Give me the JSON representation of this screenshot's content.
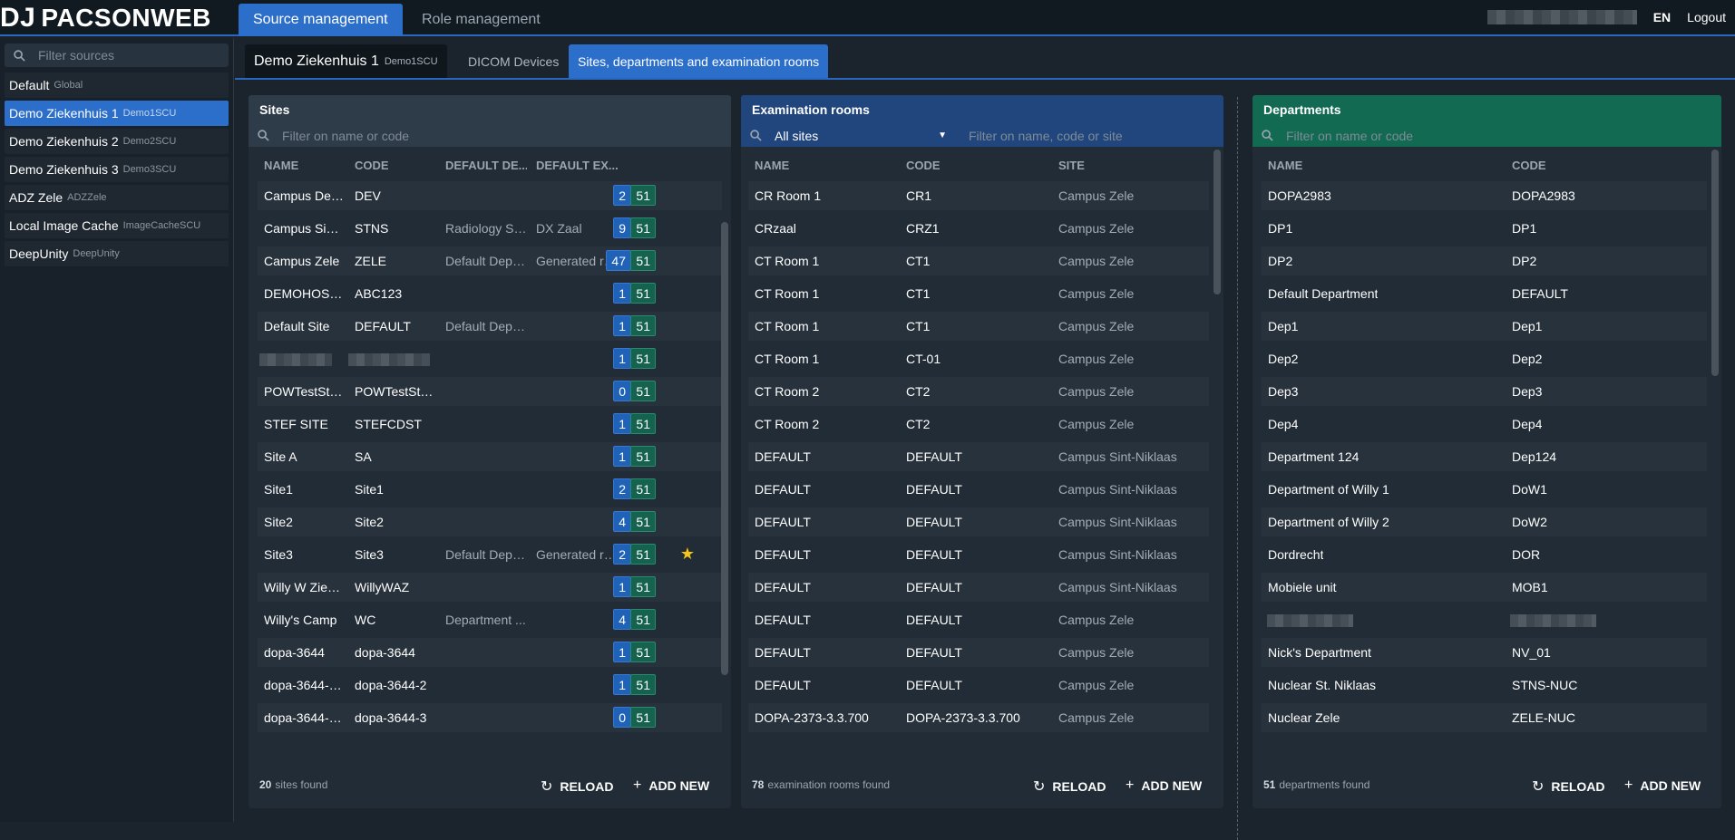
{
  "app": {
    "logo_mark": "DJ",
    "logo_text": "PACSONWEB"
  },
  "top_tabs": [
    "Source management",
    "Role management"
  ],
  "top_right": {
    "language": "EN",
    "logout": "Logout"
  },
  "sidebar": {
    "filter_placeholder": "Filter sources",
    "items": [
      {
        "name": "Default",
        "code": "Global"
      },
      {
        "name": "Demo Ziekenhuis 1",
        "code": "Demo1SCU"
      },
      {
        "name": "Demo Ziekenhuis 2",
        "code": "Demo2SCU"
      },
      {
        "name": "Demo Ziekenhuis 3",
        "code": "Demo3SCU"
      },
      {
        "name": "ADZ Zele",
        "code": "ADZZele"
      },
      {
        "name": "Local Image Cache",
        "code": "ImageCacheSCU"
      },
      {
        "name": "DeepUnity",
        "code": "DeepUnity"
      }
    ]
  },
  "subtabs": {
    "source_name": "Demo Ziekenhuis 1",
    "source_code": "Demo1SCU",
    "dicom": "DICOM Devices",
    "sites": "Sites, departments and examination rooms"
  },
  "sites": {
    "title": "Sites",
    "filter_placeholder": "Filter on name or code",
    "columns": [
      "NAME",
      "CODE",
      "DEFAULT DE...",
      "DEFAULT EX..."
    ],
    "rows": [
      {
        "name": "Campus Dev...",
        "code": "DEV",
        "dept": "",
        "exam": "",
        "n1": "2",
        "n2": "51"
      },
      {
        "name": "Campus Sint-...",
        "code": "STNS",
        "dept": "Radiology St...",
        "exam": "DX Zaal",
        "n1": "9",
        "n2": "51"
      },
      {
        "name": "Campus Zele",
        "code": "ZELE",
        "dept": "Default Depa...",
        "exam": "Generated ro...",
        "n1": "47",
        "n2": "51"
      },
      {
        "name": "DEMOHOSPI...",
        "code": "ABC123",
        "dept": "",
        "exam": "",
        "n1": "1",
        "n2": "51"
      },
      {
        "name": "Default Site",
        "code": "DEFAULT",
        "dept": "Default Depa...",
        "exam": "",
        "n1": "1",
        "n2": "51"
      },
      {
        "name": "",
        "code": "",
        "dept": "",
        "exam": "",
        "n1": "1",
        "n2": "51",
        "blurred": true
      },
      {
        "name": "POWTestStu...",
        "code": "POWTestStu...",
        "dept": "",
        "exam": "",
        "n1": "0",
        "n2": "51"
      },
      {
        "name": "STEF SITE",
        "code": "STEFCDST",
        "dept": "",
        "exam": "",
        "n1": "1",
        "n2": "51"
      },
      {
        "name": "Site A",
        "code": "SA",
        "dept": "",
        "exam": "",
        "n1": "1",
        "n2": "51"
      },
      {
        "name": "Site1",
        "code": "Site1",
        "dept": "",
        "exam": "",
        "n1": "2",
        "n2": "51"
      },
      {
        "name": "Site2",
        "code": "Site2",
        "dept": "",
        "exam": "",
        "n1": "4",
        "n2": "51"
      },
      {
        "name": "Site3",
        "code": "Site3",
        "dept": "Default Depa...",
        "exam": "Generated ro...",
        "n1": "2",
        "n2": "51",
        "star": true
      },
      {
        "name": "Willy W Zieke...",
        "code": "WillyWAZ",
        "dept": "",
        "exam": "",
        "n1": "1",
        "n2": "51"
      },
      {
        "name": "Willy's Camp",
        "code": "WC",
        "dept": "Department ...",
        "exam": "",
        "n1": "4",
        "n2": "51"
      },
      {
        "name": "dopa-3644",
        "code": "dopa-3644",
        "dept": "",
        "exam": "",
        "n1": "1",
        "n2": "51"
      },
      {
        "name": "dopa-3644-2-3",
        "code": "dopa-3644-2",
        "dept": "",
        "exam": "",
        "n1": "1",
        "n2": "51"
      },
      {
        "name": "dopa-3644-3-...",
        "code": "dopa-3644-3",
        "dept": "",
        "exam": "",
        "n1": "0",
        "n2": "51"
      }
    ],
    "count": "20",
    "count_label": "sites found"
  },
  "exam": {
    "title": "Examination rooms",
    "site_select": "All sites",
    "filter_placeholder": "Filter on name, code or site",
    "columns": [
      "NAME",
      "CODE",
      "SITE"
    ],
    "rows": [
      [
        "CR Room 1",
        "CR1",
        "Campus Zele"
      ],
      [
        "CRzaal",
        "CRZ1",
        "Campus Zele"
      ],
      [
        "CT Room 1",
        "CT1",
        "Campus Zele"
      ],
      [
        "CT Room 1",
        "CT1",
        "Campus Zele"
      ],
      [
        "CT Room 1",
        "CT1",
        "Campus Zele"
      ],
      [
        "CT Room 1",
        "CT-01",
        "Campus Zele"
      ],
      [
        "CT Room 2",
        "CT2",
        "Campus Zele"
      ],
      [
        "CT Room 2",
        "CT2",
        "Campus Zele"
      ],
      [
        "DEFAULT",
        "DEFAULT",
        "Campus Sint-Niklaas"
      ],
      [
        "DEFAULT",
        "DEFAULT",
        "Campus Sint-Niklaas"
      ],
      [
        "DEFAULT",
        "DEFAULT",
        "Campus Sint-Niklaas"
      ],
      [
        "DEFAULT",
        "DEFAULT",
        "Campus Sint-Niklaas"
      ],
      [
        "DEFAULT",
        "DEFAULT",
        "Campus Sint-Niklaas"
      ],
      [
        "DEFAULT",
        "DEFAULT",
        "Campus Zele"
      ],
      [
        "DEFAULT",
        "DEFAULT",
        "Campus Zele"
      ],
      [
        "DEFAULT",
        "DEFAULT",
        "Campus Zele"
      ],
      [
        "DOPA-2373-3.3.700",
        "DOPA-2373-3.3.700",
        "Campus Zele"
      ]
    ],
    "count": "78",
    "count_label": "examination rooms found"
  },
  "depts": {
    "title": "Departments",
    "filter_placeholder": "Filter on name or code",
    "columns": [
      "NAME",
      "CODE"
    ],
    "rows": [
      [
        "DOPA2983",
        "DOPA2983"
      ],
      [
        "DP1",
        "DP1"
      ],
      [
        "DP2",
        "DP2"
      ],
      [
        "Default Department",
        "DEFAULT"
      ],
      [
        "Dep1",
        "Dep1"
      ],
      [
        "Dep2",
        "Dep2"
      ],
      [
        "Dep3",
        "Dep3"
      ],
      [
        "Dep4",
        "Dep4"
      ],
      [
        "Department 124",
        "Dep124"
      ],
      [
        "Department of Willy 1",
        "DoW1"
      ],
      [
        "Department of Willy 2",
        "DoW2"
      ],
      [
        "Dordrecht",
        "DOR"
      ],
      [
        "Mobiele unit",
        "MOB1"
      ],
      [
        "",
        "",
        true
      ],
      [
        "Nick's Department",
        "NV_01"
      ],
      [
        "Nuclear St. Niklaas",
        "STNS-NUC"
      ],
      [
        "Nuclear Zele",
        "ZELE-NUC"
      ]
    ],
    "count": "51",
    "count_label": "departments found"
  },
  "actions": {
    "reload": "RELOAD",
    "add_new": "ADD NEW"
  },
  "colors": {
    "accent": "#2c6fcb",
    "exam_header": "#20467d",
    "dept_header": "#126a52",
    "star": "#f5c518"
  }
}
